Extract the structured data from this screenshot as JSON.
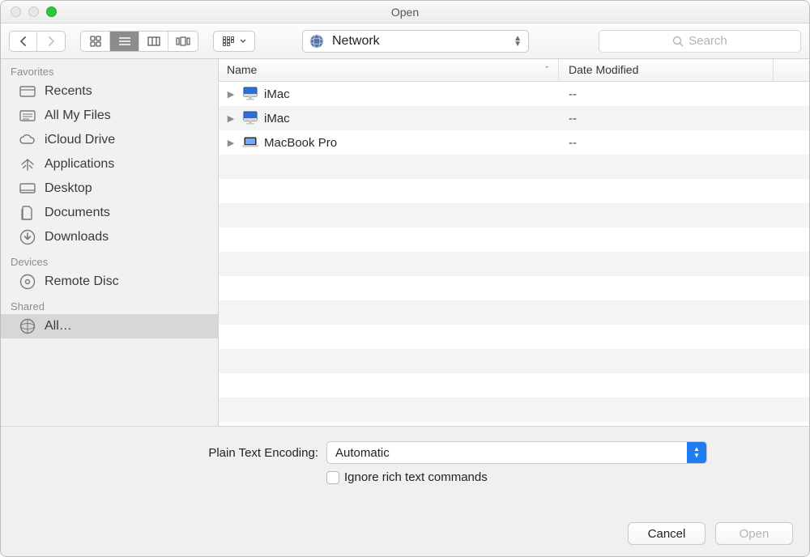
{
  "window": {
    "title": "Open"
  },
  "toolbar": {
    "location": "Network",
    "search_placeholder": "Search"
  },
  "sidebar": {
    "sections": [
      {
        "title": "Favorites",
        "items": [
          "Recents",
          "All My Files",
          "iCloud Drive",
          "Applications",
          "Desktop",
          "Documents",
          "Downloads"
        ]
      },
      {
        "title": "Devices",
        "items": [
          "Remote Disc"
        ]
      },
      {
        "title": "Shared",
        "items": [
          "All…"
        ]
      }
    ]
  },
  "columns": [
    "Name",
    "Date Modified"
  ],
  "rows": [
    {
      "kind": "imac",
      "name": "iMac",
      "date": "--"
    },
    {
      "kind": "imac",
      "name": "iMac",
      "date": "--"
    },
    {
      "kind": "macbook",
      "name": "MacBook Pro",
      "date": "--"
    }
  ],
  "options": {
    "encoding_label": "Plain Text Encoding:",
    "encoding_value": "Automatic",
    "ignore_rich_label": "Ignore rich text commands"
  },
  "buttons": {
    "cancel": "Cancel",
    "open": "Open"
  }
}
